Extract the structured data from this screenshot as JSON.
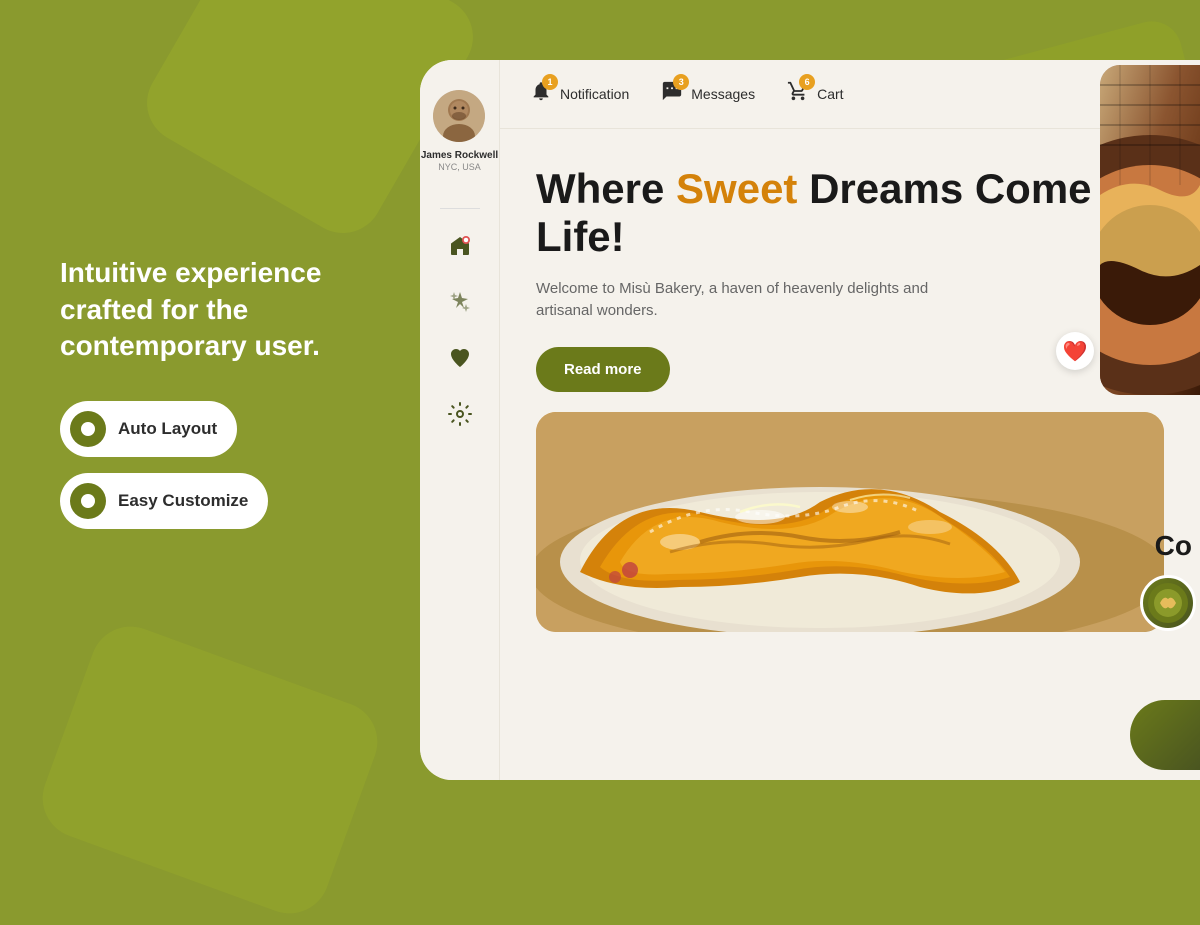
{
  "background": {
    "color": "#8a9a2e"
  },
  "left_panel": {
    "tagline": "Intuitive experience crafted for the contemporary user.",
    "badges": [
      {
        "id": "auto-layout",
        "label": "Auto Layout"
      },
      {
        "id": "easy-customize",
        "label": "Easy Customize"
      }
    ]
  },
  "sidebar": {
    "user": {
      "name": "James Rockwell",
      "location": "NYC, USA"
    },
    "icons": [
      {
        "id": "home-icon",
        "symbol": "🏠"
      },
      {
        "id": "sparkle-icon",
        "symbol": "✦"
      },
      {
        "id": "heart-icon",
        "symbol": "♥"
      },
      {
        "id": "settings-icon",
        "symbol": "⚙"
      }
    ]
  },
  "topbar": {
    "items": [
      {
        "id": "notification",
        "icon": "🔔",
        "label": "Notification",
        "count": "1"
      },
      {
        "id": "messages",
        "icon": "💬",
        "label": "Messages",
        "count": "3"
      },
      {
        "id": "cart",
        "icon": "🛒",
        "label": "Cart",
        "count": "6"
      }
    ]
  },
  "hero": {
    "title_part1": "Where ",
    "title_sweet": "Sweet",
    "title_part2": " Dreams Come to Life!",
    "description": "Welcome to Misù Bakery, a haven of heavenly delights and artisanal wonders.",
    "read_more_label": "Read more"
  },
  "image_section": {
    "alt": "Croissant on plate with powdered sugar"
  },
  "partial_right": {
    "text": "Co...",
    "nav_label": "‹"
  },
  "colors": {
    "olive": "#6b7a1a",
    "orange": "#d4820a",
    "bg_card": "#f5f2ec"
  }
}
